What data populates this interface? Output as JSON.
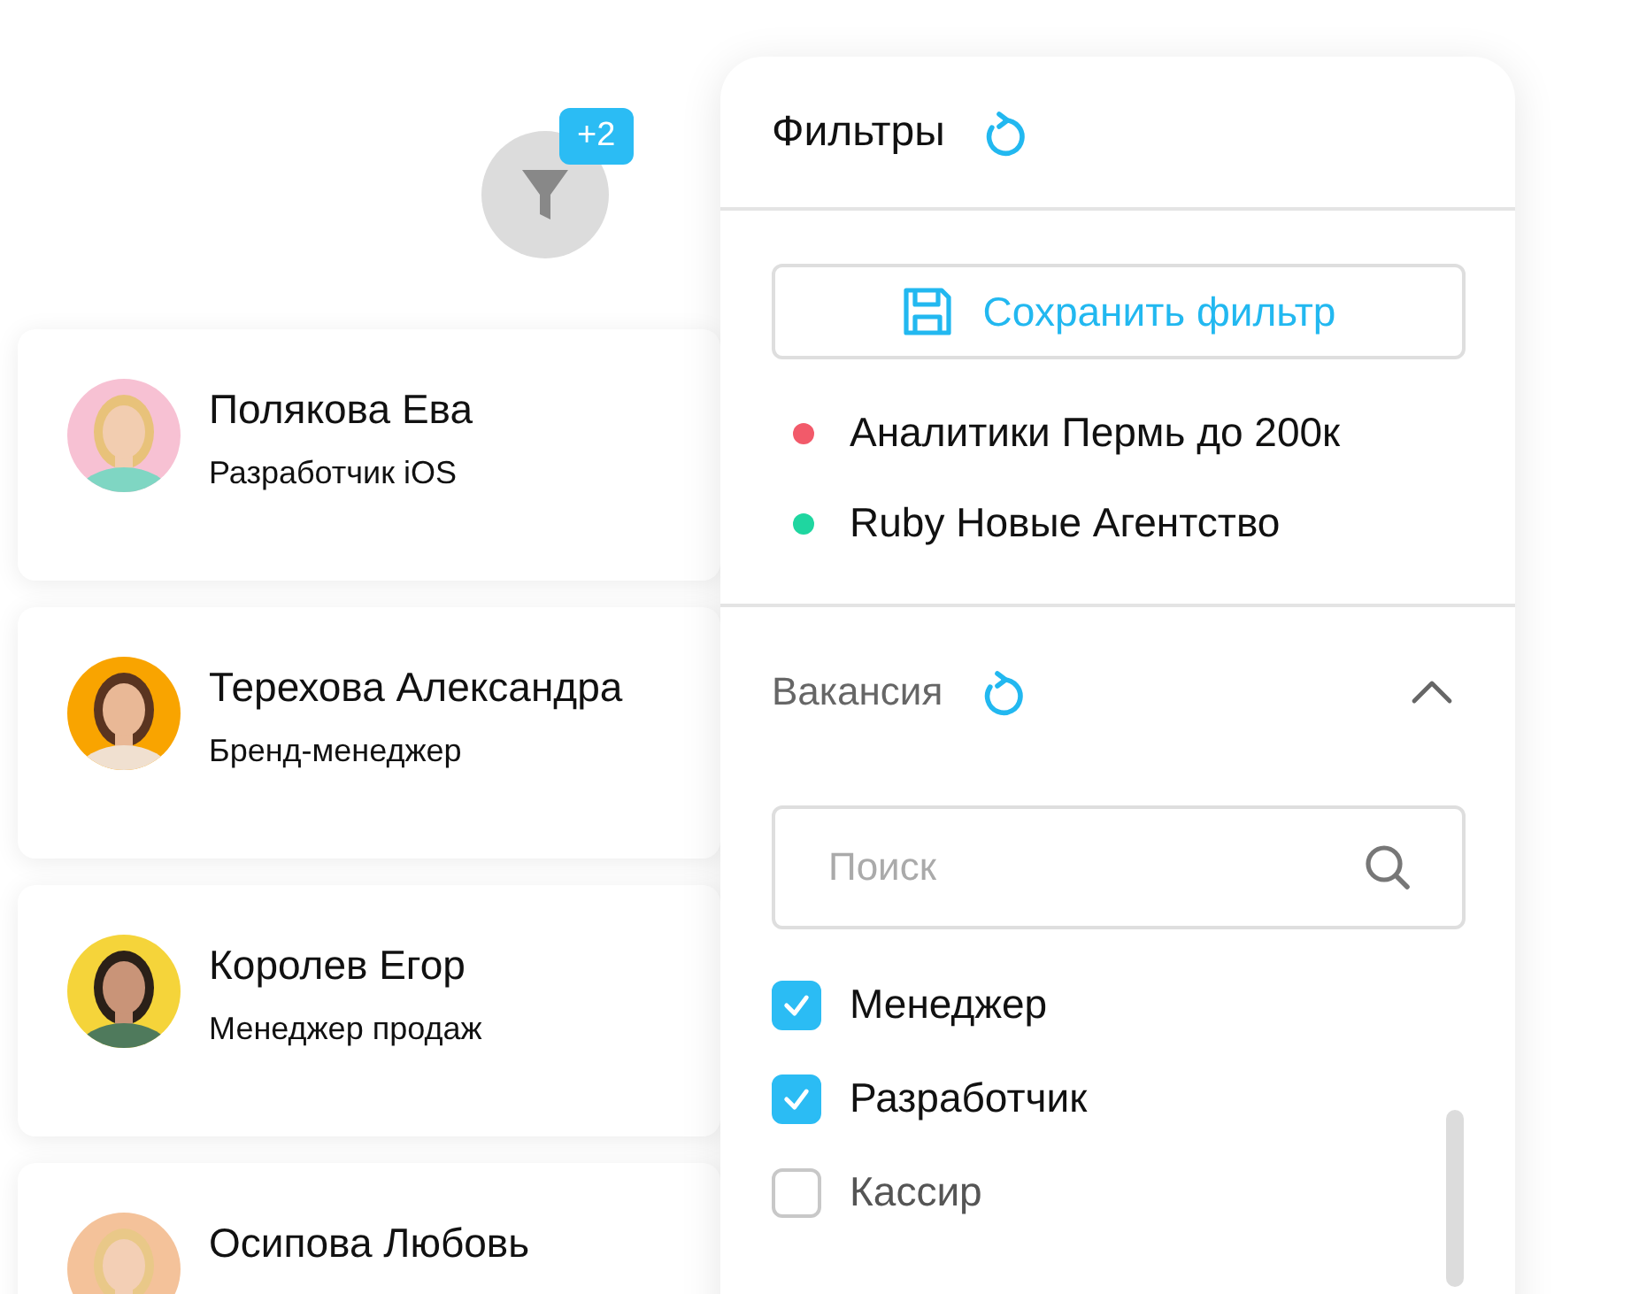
{
  "filter_button": {
    "badge": "+2"
  },
  "candidates": [
    {
      "name": "Полякова Ева",
      "role": "Разработчик iOS"
    },
    {
      "name": "Терехова Александра",
      "role": "Бренд-менеджер"
    },
    {
      "name": "Королев Егор",
      "role": "Менеджер продаж"
    },
    {
      "name": "Осипова Любовь"
    }
  ],
  "filters_panel": {
    "title": "Фильтры",
    "save_button": "Сохранить фильтр",
    "saved_filters": [
      {
        "label": "Аналитики Пермь до 200к",
        "color": "#f25a6a"
      },
      {
        "label": "Ruby Новые Агентство",
        "color": "#1fd6a0"
      }
    ],
    "section": {
      "title": "Вакансия",
      "expanded": true,
      "search": {
        "placeholder": "Поиск"
      },
      "options": [
        {
          "label": "Менеджер",
          "checked": true
        },
        {
          "label": "Разработчик",
          "checked": true
        },
        {
          "label": "Кассир",
          "checked": false
        }
      ]
    }
  }
}
